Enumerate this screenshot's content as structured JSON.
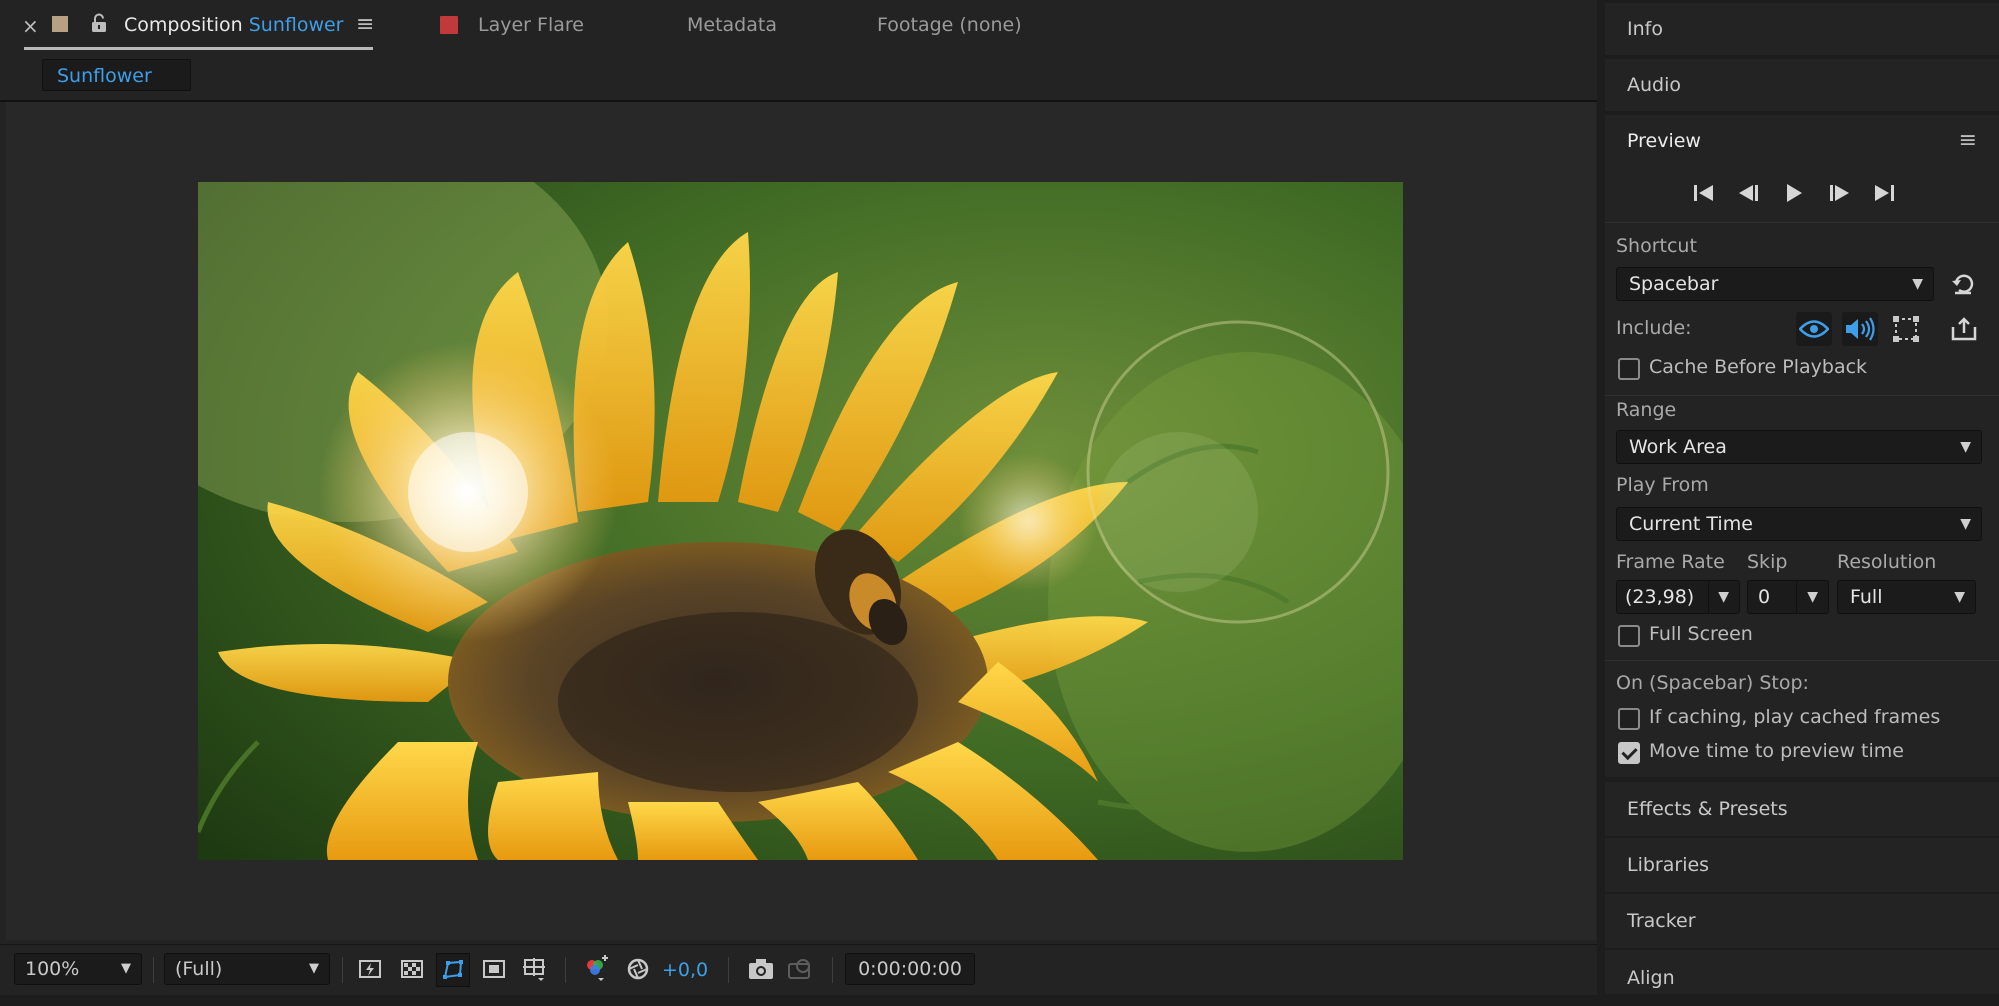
{
  "composition_tab": {
    "close_glyph": "×",
    "label_prefix": "Composition",
    "label_name": "Sunflower",
    "menu_glyph": "≡",
    "color_swatch": "#b8a083"
  },
  "other_tabs": [
    {
      "label": "Layer Flare",
      "swatch": "#c0393b"
    },
    {
      "label": "Metadata"
    },
    {
      "label": "Footage (none)"
    }
  ],
  "flowchart_chip": "Sunflower",
  "viewer_controls": {
    "zoom": "100%",
    "resolution": "(Full)",
    "exposure": "+0,0",
    "timecode": "0:00:00:00"
  },
  "right_panels": {
    "info": "Info",
    "audio": "Audio",
    "preview": "Preview",
    "effects_presets": "Effects & Presets",
    "libraries": "Libraries",
    "tracker": "Tracker",
    "align": "Align"
  },
  "preview": {
    "shortcut_label": "Shortcut",
    "shortcut_value": "Spacebar",
    "include_label": "Include:",
    "cache_before_playback": "Cache Before Playback",
    "cache_before_playback_checked": false,
    "range_label": "Range",
    "range_value": "Work Area",
    "play_from_label": "Play From",
    "play_from_value": "Current Time",
    "frame_rate_label": "Frame Rate",
    "frame_rate_value": "(23,98)",
    "skip_label": "Skip",
    "skip_value": "0",
    "resolution_label": "Resolution",
    "resolution_value": "Full",
    "full_screen": "Full Screen",
    "full_screen_checked": false,
    "stop_label": "On (Spacebar) Stop:",
    "if_caching": "If caching, play cached frames",
    "if_caching_checked": false,
    "move_time": "Move time to preview time",
    "move_time_checked": true
  },
  "accent_color": "#3e9ee8"
}
